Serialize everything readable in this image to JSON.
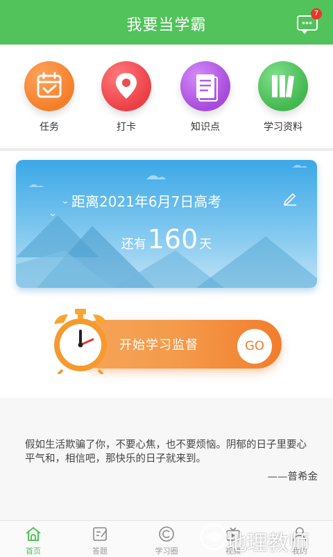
{
  "header": {
    "title": "我要当学霸",
    "message_badge": "7"
  },
  "quick_actions": [
    {
      "label": "任务",
      "icon": "calendar-check-icon",
      "color": "#f47f2a"
    },
    {
      "label": "打卡",
      "icon": "location-pin-icon",
      "color": "#ee4b4f"
    },
    {
      "label": "知识点",
      "icon": "notebook-icon",
      "color": "#b45be6"
    },
    {
      "label": "学习资料",
      "icon": "books-icon",
      "color": "#4fc05a"
    }
  ],
  "countdown": {
    "title": "距离2021年6月7日高考",
    "prefix": "还有",
    "days": "160",
    "suffix": "天"
  },
  "supervise": {
    "label": "开始学习监督",
    "go_label": "GO"
  },
  "quote": {
    "text": "假如生活欺骗了你，不要心焦，也不要烦恼。阴郁的日子里要心平气和，相信吧，那快乐的日子就来到。",
    "author": "——普希金"
  },
  "tabs": [
    {
      "label": "首页",
      "icon": "home-icon",
      "active": true
    },
    {
      "label": "答题",
      "icon": "edit-note-icon",
      "active": false
    },
    {
      "label": "学习圈",
      "icon": "copyright-circle-icon",
      "active": false
    },
    {
      "label": "视频",
      "icon": "tv-icon",
      "active": false
    },
    {
      "label": "我的",
      "icon": "user-icon",
      "active": false
    }
  ],
  "watermark": "地理教师"
}
